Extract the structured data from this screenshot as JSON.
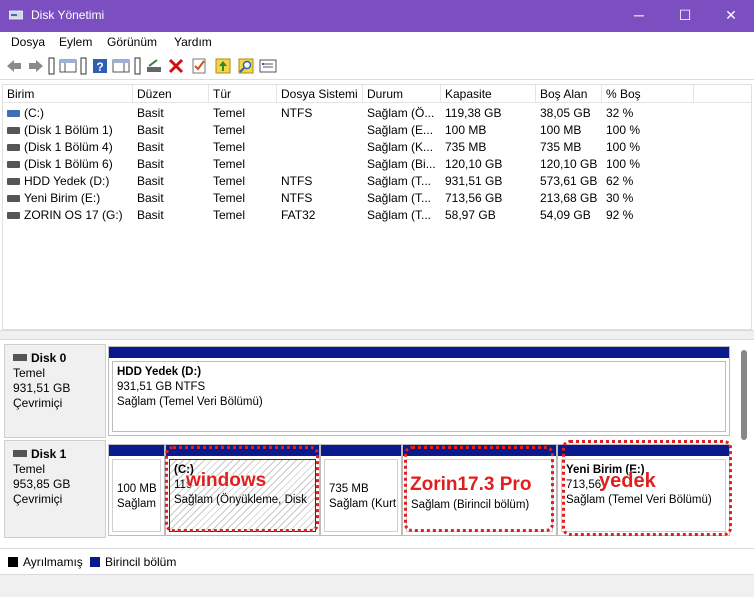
{
  "window": {
    "title": "Disk Yönetimi",
    "accent_color": "#7b4fc0",
    "controls": {
      "minimize": "─",
      "maximize": "☐",
      "close": "✕"
    }
  },
  "menu": [
    "Dosya",
    "Eylem",
    "Görünüm",
    "Yardım"
  ],
  "toolbar": {
    "icons": [
      "back-arrow-icon",
      "forward-arrow-icon",
      "console-tree-icon",
      "properties-icon",
      "help-icon",
      "action-pane-icon",
      "connect-disk-icon",
      "delete-icon",
      "checklist-icon",
      "rescan-icon",
      "search-icon",
      "settings-icon"
    ]
  },
  "list": {
    "columns": [
      "Birim",
      "Düzen",
      "Tür",
      "Dosya Sistemi",
      "Durum",
      "Kapasite",
      "Boş Alan",
      "% Boş"
    ],
    "rows": [
      [
        "(C:)",
        "Basit",
        "Temel",
        "NTFS",
        "Sağlam (Ö...",
        "119,38 GB",
        "38,05 GB",
        "32 %"
      ],
      [
        "(Disk 1 Bölüm 1)",
        "Basit",
        "Temel",
        "",
        "Sağlam (E...",
        "100 MB",
        "100 MB",
        "100 %"
      ],
      [
        "(Disk 1 Bölüm 4)",
        "Basit",
        "Temel",
        "",
        "Sağlam (K...",
        "735 MB",
        "735 MB",
        "100 %"
      ],
      [
        "(Disk 1 Bölüm 6)",
        "Basit",
        "Temel",
        "",
        "Sağlam (Bi...",
        "120,10 GB",
        "120,10 GB",
        "100 %"
      ],
      [
        "HDD Yedek (D:)",
        "Basit",
        "Temel",
        "NTFS",
        "Sağlam (T...",
        "931,51 GB",
        "573,61 GB",
        "62 %"
      ],
      [
        "Yeni Birim (E:)",
        "Basit",
        "Temel",
        "NTFS",
        "Sağlam (T...",
        "713,56 GB",
        "213,68 GB",
        "30 %"
      ],
      [
        "ZORIN OS 17 (G:)",
        "Basit",
        "Temel",
        "FAT32",
        "Sağlam (T...",
        "58,97 GB",
        "54,09 GB",
        "92 %"
      ]
    ]
  },
  "disks": [
    {
      "name": "Disk 0",
      "type": "Temel",
      "size": "931,51 GB",
      "status": "Çevrimiçi",
      "partitions": [
        {
          "title": "HDD Yedek  (D:)",
          "line1": "931,51 GB NTFS",
          "line2": "Sağlam (Temel Veri Bölümü)"
        }
      ]
    },
    {
      "name": "Disk 1",
      "type": "Temel",
      "size": "953,85 GB",
      "status": "Çevrimiçi",
      "partitions": [
        {
          "title": "",
          "line1": "100 MB",
          "line2": "Sağlam"
        },
        {
          "title": "(C:)",
          "line1": "119",
          "line2": "Sağlam (Önyükleme, Disk"
        },
        {
          "title": "",
          "line1": "735 MB",
          "line2": "Sağlam (Kurt"
        },
        {
          "title": "",
          "line1": "",
          "line2": "Sağlam (Birincil bölüm)"
        },
        {
          "title": "Yeni Birim  (E:)",
          "line1": "713,56",
          "line2": "Sağlam (Temel Veri Bölümü)"
        }
      ]
    }
  ],
  "annotations": [
    "windows",
    "Zorin17.3 Pro",
    "yedek"
  ],
  "annotation_color": "#e02020",
  "legend": [
    {
      "label": "Ayrılmamış",
      "color": "#000000"
    },
    {
      "label": "Birincil bölüm",
      "color": "#0a1a8c"
    }
  ]
}
